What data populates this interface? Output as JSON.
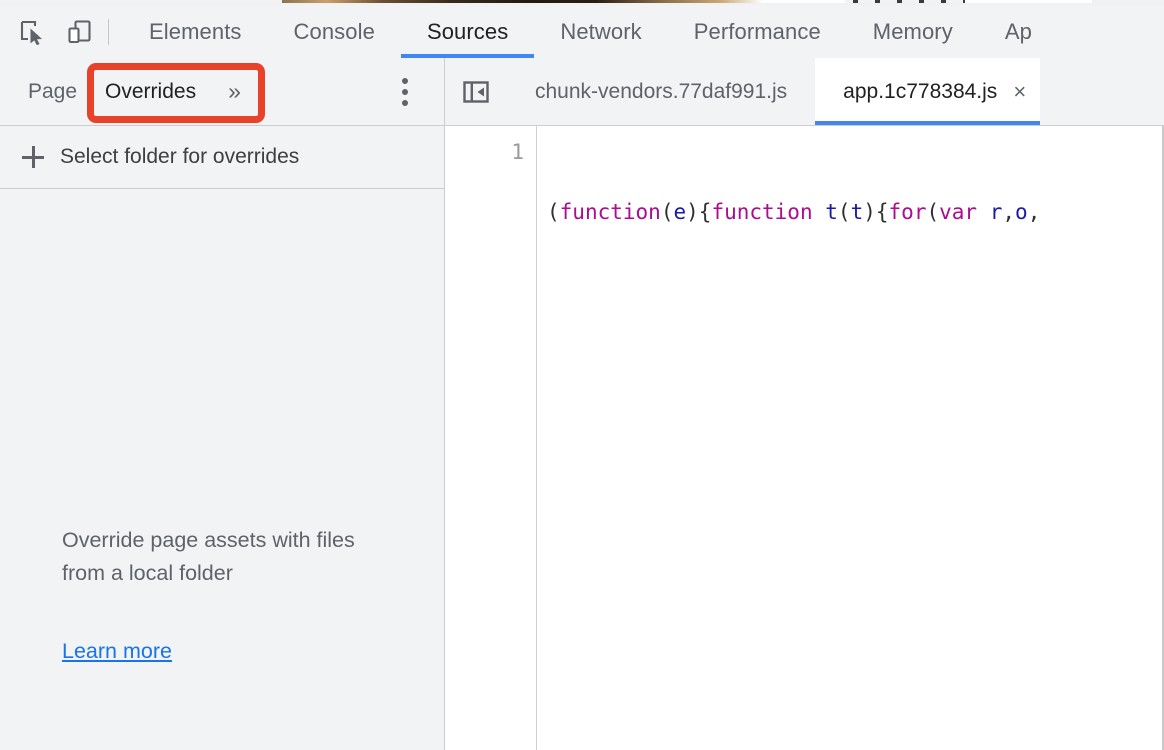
{
  "window": {
    "app": "Chrome DevTools",
    "accent_blue": "#4285f4",
    "link_blue": "#1a73e8",
    "annotation_red": "#e8422a",
    "toolbar_bg": "#f1f3f4",
    "panel_bg": "#ffffff"
  },
  "toolbar": {
    "inspect_icon": "inspect-element-icon",
    "device_icon": "device-toolbar-icon",
    "tabs": [
      {
        "label": "Elements",
        "selected": false
      },
      {
        "label": "Console",
        "selected": false
      },
      {
        "label": "Sources",
        "selected": true
      },
      {
        "label": "Network",
        "selected": false
      },
      {
        "label": "Performance",
        "selected": false
      },
      {
        "label": "Memory",
        "selected": false
      },
      {
        "label": "Ap",
        "selected": false,
        "truncated": true
      }
    ]
  },
  "navigator": {
    "tabs": [
      {
        "label": "Page",
        "active": false
      },
      {
        "label": "Overrides",
        "active": true,
        "highlighted": true
      }
    ],
    "more_tabs_icon": "chevron-double-right-icon",
    "more_options_icon": "kebab-menu-icon",
    "select_folder": {
      "icon": "plus-icon",
      "label": "Select folder for overrides"
    },
    "empty_state": {
      "message": "Override page assets with files from a local folder",
      "learn_more": "Learn more"
    }
  },
  "editor": {
    "navigator_toggle_icon": "show-navigator-panel-icon",
    "tabs": [
      {
        "label": "chunk-vendors.77daf991.js",
        "active": false,
        "closable": false
      },
      {
        "label": "app.1c778384.js",
        "active": true,
        "closable": true,
        "close_icon": "close-icon"
      }
    ],
    "close_glyph": "×",
    "line_numbers": [
      "1"
    ],
    "code_tokens": [
      {
        "t": "(",
        "c": "pn"
      },
      {
        "t": "function",
        "c": "kw"
      },
      {
        "t": "(",
        "c": "pn"
      },
      {
        "t": "e",
        "c": "idn"
      },
      {
        "t": ")",
        "c": "pn"
      },
      {
        "t": "{",
        "c": "pn"
      },
      {
        "t": "function",
        "c": "kw"
      },
      {
        "t": " ",
        "c": "pn"
      },
      {
        "t": "t",
        "c": "idn"
      },
      {
        "t": "(",
        "c": "pn"
      },
      {
        "t": "t",
        "c": "idn"
      },
      {
        "t": ")",
        "c": "pn"
      },
      {
        "t": "{",
        "c": "pn"
      },
      {
        "t": "for",
        "c": "kw"
      },
      {
        "t": "(",
        "c": "pn"
      },
      {
        "t": "var",
        "c": "kw"
      },
      {
        "t": " ",
        "c": "pn"
      },
      {
        "t": "r",
        "c": "idn"
      },
      {
        "t": ",",
        "c": "pn"
      },
      {
        "t": "o",
        "c": "idn"
      },
      {
        "t": ",",
        "c": "pn"
      }
    ]
  }
}
